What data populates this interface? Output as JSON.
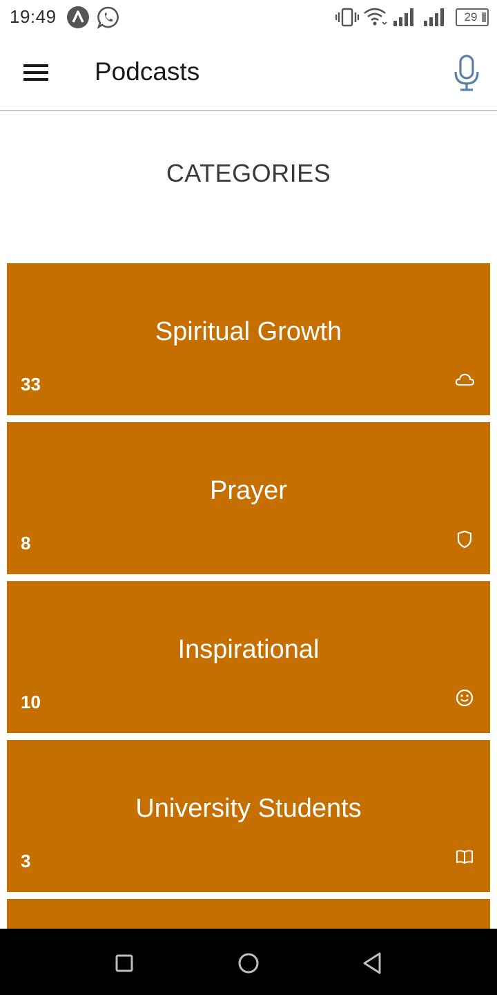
{
  "status_bar": {
    "time": "19:49",
    "battery": "29",
    "icons": [
      "notification-a-icon",
      "whatsapp-icon",
      "vibrate-icon",
      "wifi-icon",
      "signal-icon",
      "signal-icon",
      "battery-icon"
    ]
  },
  "app_bar": {
    "title": "Podcasts",
    "menu_icon": "hamburger-menu-icon",
    "mic_icon": "microphone-icon"
  },
  "section": {
    "title": "CATEGORIES"
  },
  "categories": [
    {
      "title": "Spiritual Growth",
      "count": "33",
      "icon": "cloud-icon"
    },
    {
      "title": "Prayer",
      "count": "8",
      "icon": "shield-icon"
    },
    {
      "title": "Inspirational",
      "count": "10",
      "icon": "smiley-icon"
    },
    {
      "title": "University Students",
      "count": "3",
      "icon": "book-icon"
    }
  ],
  "colors": {
    "card": "#c56f01",
    "mic": "#5b7fa6"
  },
  "nav_bar": {
    "icons": [
      "recent-apps-icon",
      "home-icon",
      "back-icon"
    ]
  }
}
